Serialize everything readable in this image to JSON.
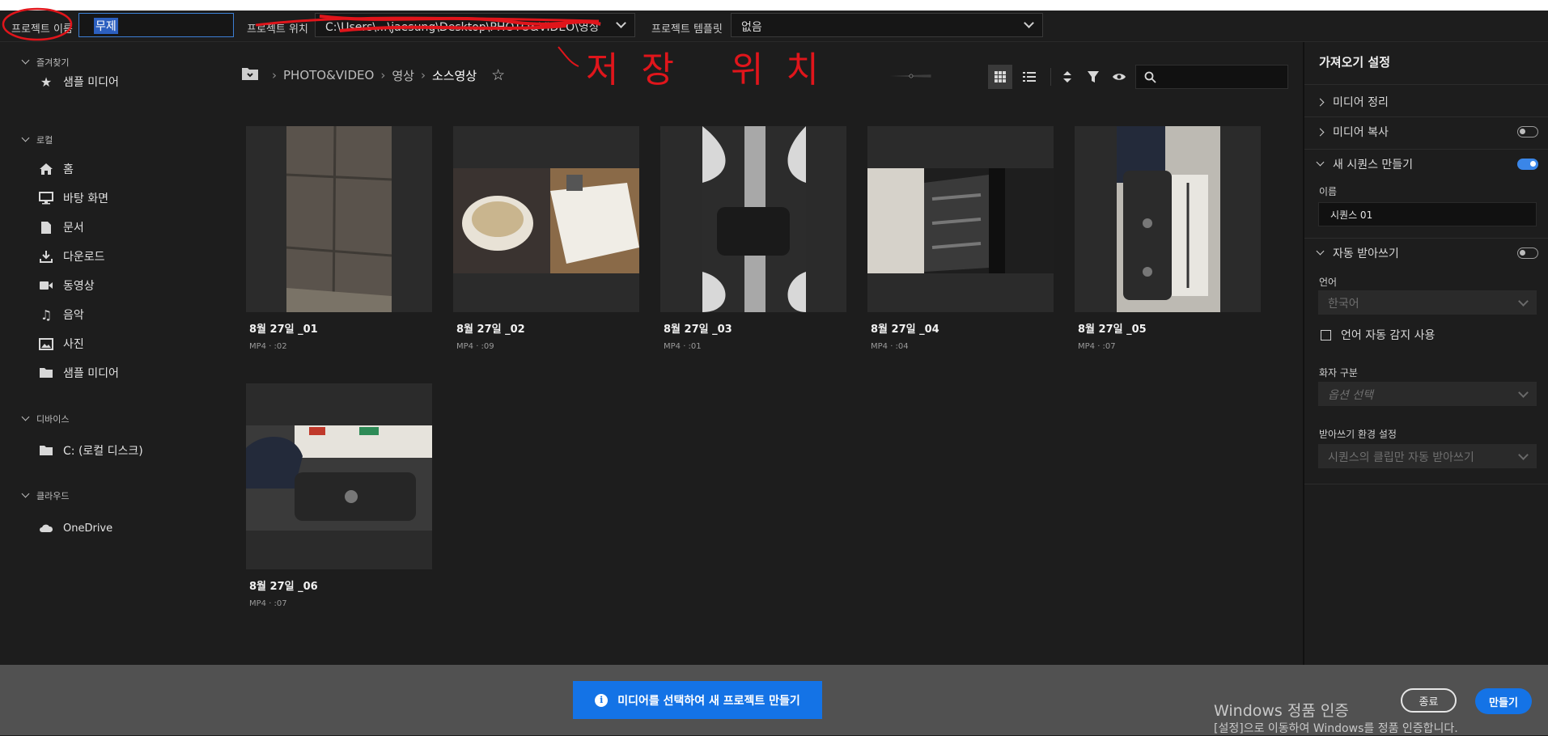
{
  "topbar": {
    "project_name_label": "프로젝트 이름",
    "project_name_value": "무제",
    "project_location_label": "프로젝트 위치",
    "project_location_value": "C:\\Users\\...\\jaesung\\Desktop\\PHOTO&VIDEO\\영상\\...",
    "project_template_label": "프로젝트 템플릿",
    "project_template_value": "없음"
  },
  "annotation_text": "저장 위치",
  "sidebar": {
    "favorites_label": "즐겨찾기",
    "favorites": [
      {
        "label": "샘플 미디어",
        "icon": "star-icon"
      }
    ],
    "local_label": "로컬",
    "local": [
      {
        "label": "홈",
        "icon": "home-icon"
      },
      {
        "label": "바탕 화면",
        "icon": "monitor-icon"
      },
      {
        "label": "문서",
        "icon": "document-icon"
      },
      {
        "label": "다운로드",
        "icon": "download-icon"
      },
      {
        "label": "동영상",
        "icon": "video-icon"
      },
      {
        "label": "음악",
        "icon": "music-icon"
      },
      {
        "label": "사진",
        "icon": "image-icon"
      },
      {
        "label": "샘플 미디어",
        "icon": "folder-icon"
      }
    ],
    "devices_label": "디바이스",
    "devices": [
      {
        "label": "C: (로컬 디스크)",
        "icon": "folder-icon"
      }
    ],
    "cloud_label": "클라우드",
    "cloud": [
      {
        "label": "OneDrive",
        "icon": "cloud-icon"
      }
    ]
  },
  "breadcrumb": [
    "PHOTO&VIDEO",
    "영상",
    "소스영상"
  ],
  "thumbnail_zoom": 0.52,
  "media": [
    {
      "title": "8월 27일 _01",
      "meta": "MP4 · :02"
    },
    {
      "title": "8월 27일 _02",
      "meta": "MP4 · :09"
    },
    {
      "title": "8월 27일 _03",
      "meta": "MP4 · :01"
    },
    {
      "title": "8월 27일 _04",
      "meta": "MP4 · :04"
    },
    {
      "title": "8월 27일 _05",
      "meta": "MP4 · :07"
    },
    {
      "title": "8월 27일 _06",
      "meta": "MP4 · :07"
    }
  ],
  "import_settings": {
    "title": "가져오기 설정",
    "media_organize": "미디어 정리",
    "media_copy": "미디어 복사",
    "media_copy_on": false,
    "new_sequence": "새 시퀀스 만들기",
    "new_sequence_on": true,
    "name_label": "이름",
    "name_value": "시퀀스 01",
    "auto_transcribe": "자동 받아쓰기",
    "auto_transcribe_on": false,
    "language_label": "언어",
    "language_value": "한국어",
    "auto_detect_label": "언어 자동 감지 사용",
    "speaker_label": "화자 구분",
    "speaker_placeholder": "옵션 선택",
    "transcribe_pref_label": "받아쓰기 환경 설정",
    "transcribe_pref_value": "시퀀스의 클립만 자동 받아쓰기"
  },
  "bottom": {
    "cta": "미디어를 선택하여 새 프로젝트 만들기",
    "cancel": "종료",
    "create": "만들기",
    "watermark_title": "Windows 정품 인증",
    "watermark_sub": "[설정]으로 이동하여 Windows를 정품 인증합니다."
  },
  "colors": {
    "accent": "#1473e6",
    "annotation": "#e0151b",
    "background": "#1d1d1d"
  }
}
